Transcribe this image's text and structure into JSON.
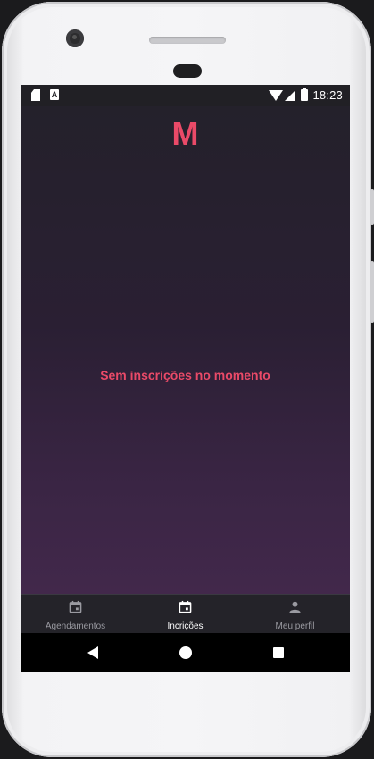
{
  "status_bar": {
    "time": "18:23",
    "left_icons": [
      "sd-card-icon",
      "a-icon"
    ],
    "a_icon_text": "A",
    "right_icons": [
      "wifi-icon",
      "signal-icon",
      "battery-icon"
    ]
  },
  "app": {
    "logo": "M",
    "empty_message": "Sem inscrições no momento",
    "colors": {
      "accent": "#ea4a68",
      "background_top": "#24212b",
      "background_bottom": "#42284b",
      "nav_background": "#242329"
    }
  },
  "bottom_nav": {
    "items": [
      {
        "label": "Agendamentos",
        "icon": "calendar-icon",
        "active": false
      },
      {
        "label": "Incrições",
        "icon": "calendar-icon",
        "active": true
      },
      {
        "label": "Meu perfil",
        "icon": "person-icon",
        "active": false
      }
    ]
  },
  "system_nav": {
    "buttons": [
      "back-icon",
      "home-icon",
      "recents-icon"
    ]
  }
}
